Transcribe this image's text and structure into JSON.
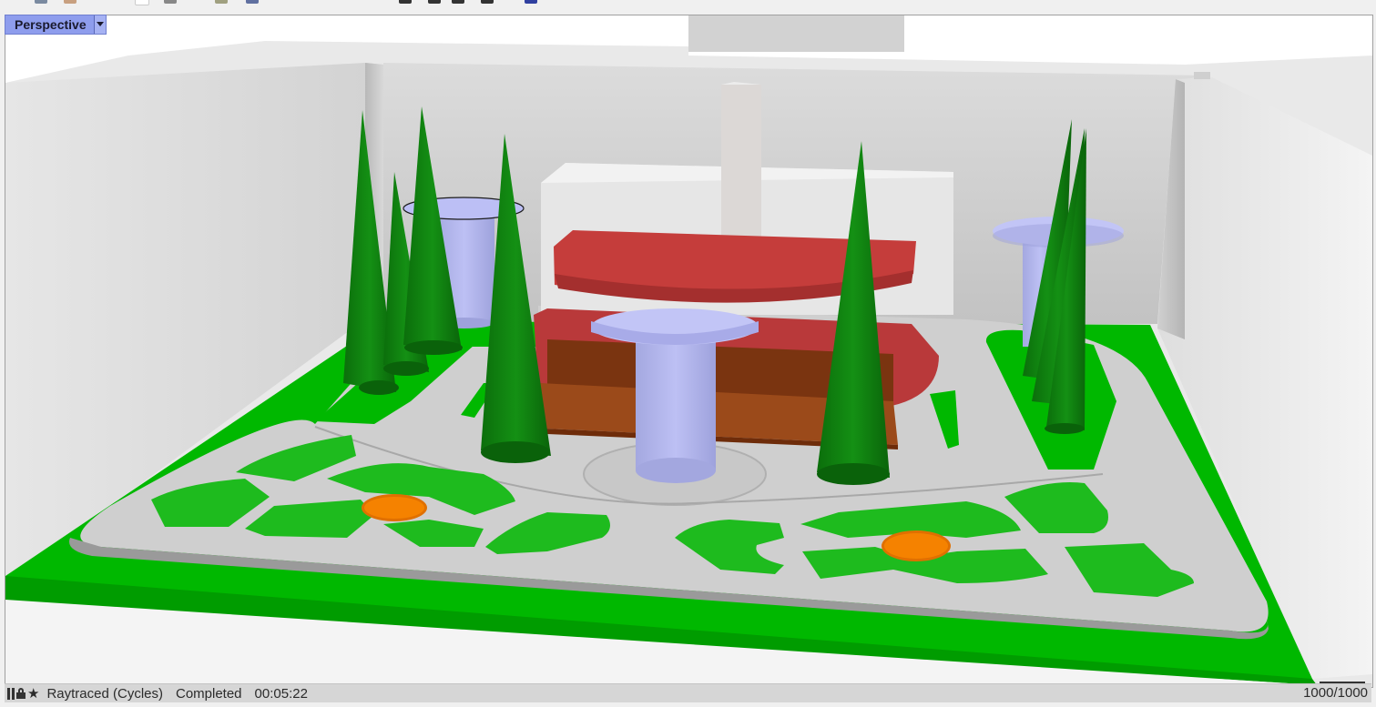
{
  "viewport": {
    "tab_label": "Perspective"
  },
  "status_bar": {
    "icons": [
      "pause-icon",
      "lock-icon",
      "star-icon"
    ],
    "renderer": "Raytraced (Cycles)",
    "state": "Completed",
    "elapsed": "00:05:22",
    "pass": "1000/1000"
  },
  "colors": {
    "grass": "#00b800",
    "tree": "#0d7a0d",
    "table": "#b8bbf2",
    "seat_red": "#c03a38",
    "seat_brown": "#8a3a10",
    "flower": "#f57c00",
    "path": "#cccccc",
    "tab_accent": "#8e9ded"
  }
}
